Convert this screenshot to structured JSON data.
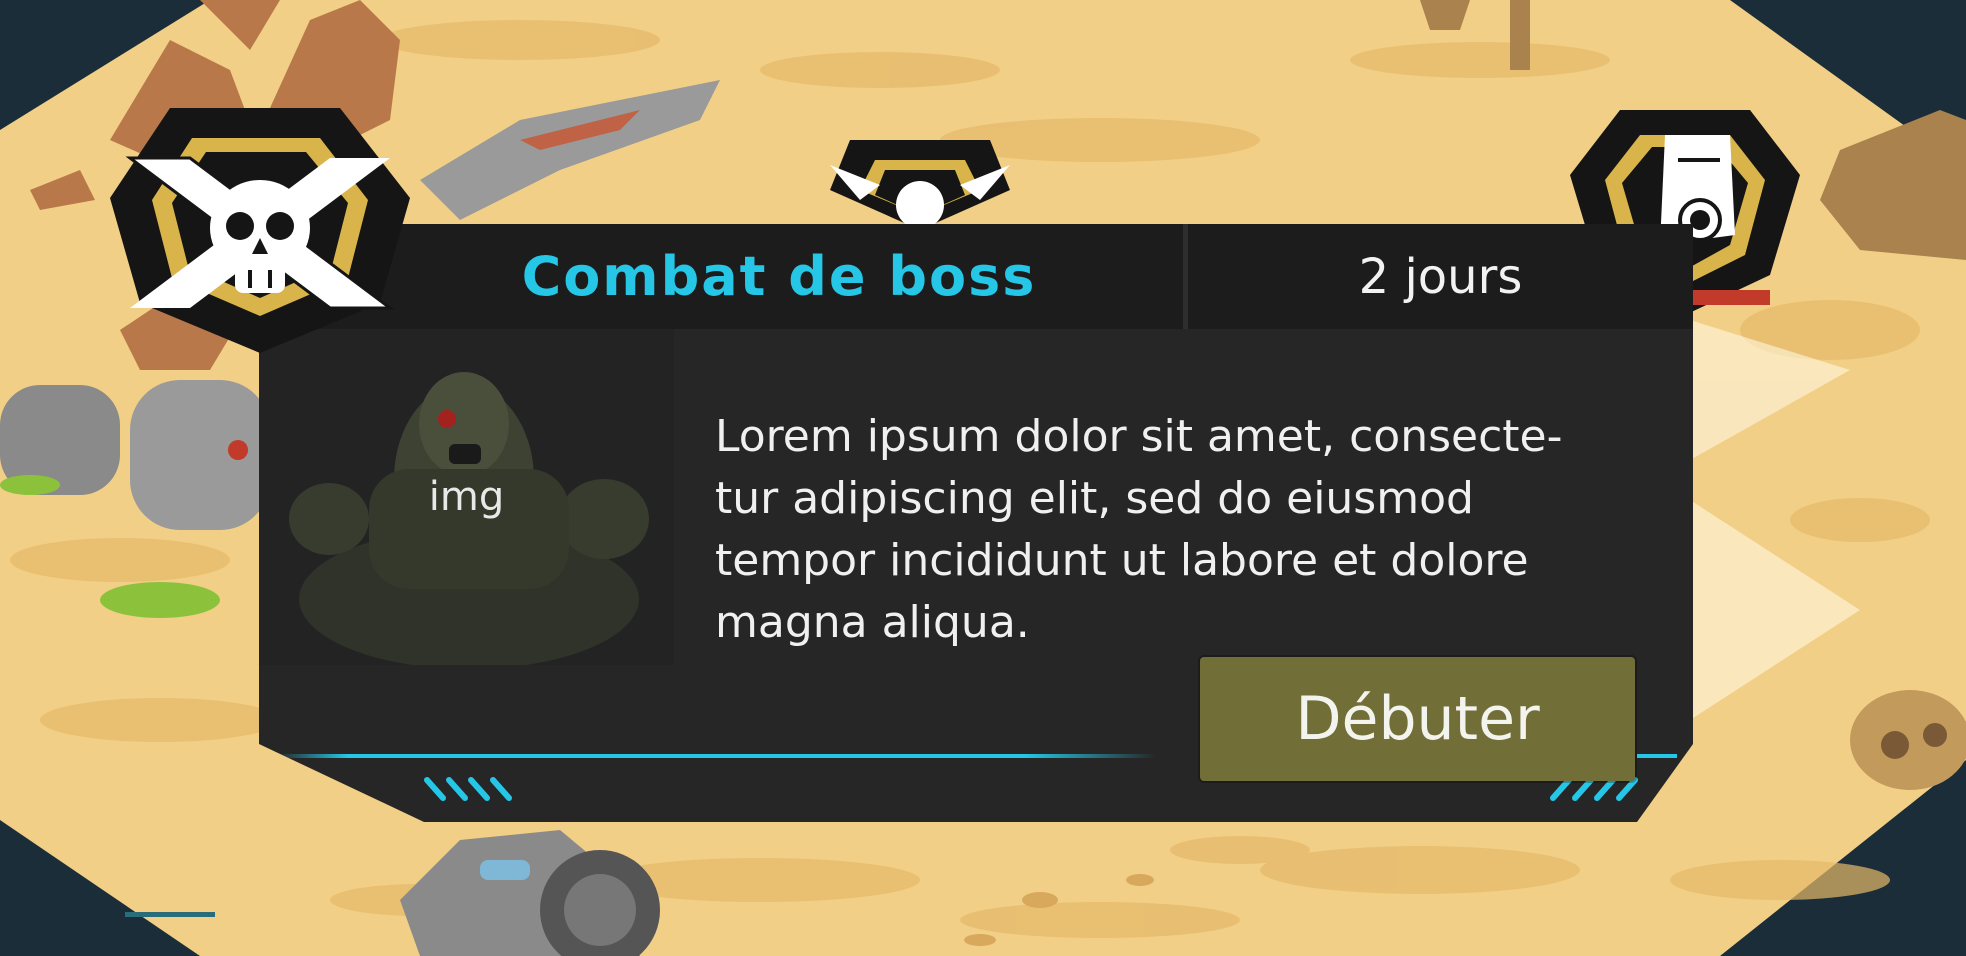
{
  "event": {
    "title": "Combat de boss",
    "timer": "2 jours",
    "image_placeholder": "img",
    "description": "Lorem ipsum dolor sit amet, consecte-\ntur adipiscing elit, sed do eiusmod\ntempor incididunt ut labore et dolore\nmagna aliqua.",
    "start_button": "Débuter"
  },
  "colors": {
    "accent": "#25c6e6",
    "button": "#726e38",
    "panel": "#262626",
    "header": "#1c1c1c",
    "sand": "#f2cf86"
  },
  "icons": [
    "skull-crossed-badge-icon",
    "skull-badge-icon",
    "document-badge-icon"
  ]
}
